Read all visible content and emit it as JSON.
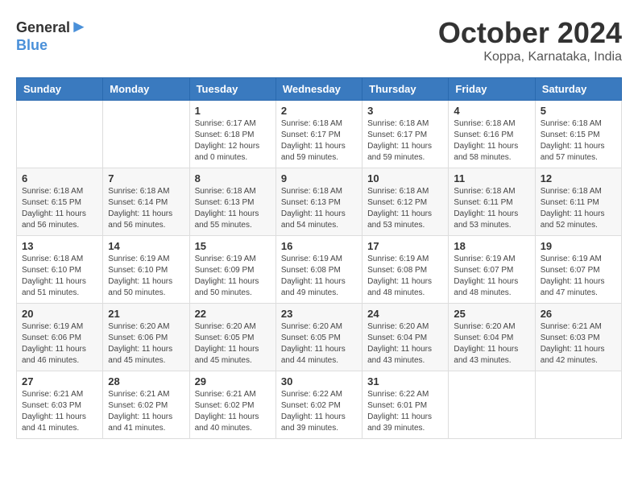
{
  "header": {
    "logo_general": "General",
    "logo_blue": "Blue",
    "title": "October 2024",
    "location": "Koppa, Karnataka, India"
  },
  "weekdays": [
    "Sunday",
    "Monday",
    "Tuesday",
    "Wednesday",
    "Thursday",
    "Friday",
    "Saturday"
  ],
  "weeks": [
    [
      {
        "day": "",
        "sunrise": "",
        "sunset": "",
        "daylight": ""
      },
      {
        "day": "",
        "sunrise": "",
        "sunset": "",
        "daylight": ""
      },
      {
        "day": "1",
        "sunrise": "Sunrise: 6:17 AM",
        "sunset": "Sunset: 6:18 PM",
        "daylight": "Daylight: 12 hours and 0 minutes."
      },
      {
        "day": "2",
        "sunrise": "Sunrise: 6:18 AM",
        "sunset": "Sunset: 6:17 PM",
        "daylight": "Daylight: 11 hours and 59 minutes."
      },
      {
        "day": "3",
        "sunrise": "Sunrise: 6:18 AM",
        "sunset": "Sunset: 6:17 PM",
        "daylight": "Daylight: 11 hours and 59 minutes."
      },
      {
        "day": "4",
        "sunrise": "Sunrise: 6:18 AM",
        "sunset": "Sunset: 6:16 PM",
        "daylight": "Daylight: 11 hours and 58 minutes."
      },
      {
        "day": "5",
        "sunrise": "Sunrise: 6:18 AM",
        "sunset": "Sunset: 6:15 PM",
        "daylight": "Daylight: 11 hours and 57 minutes."
      }
    ],
    [
      {
        "day": "6",
        "sunrise": "Sunrise: 6:18 AM",
        "sunset": "Sunset: 6:15 PM",
        "daylight": "Daylight: 11 hours and 56 minutes."
      },
      {
        "day": "7",
        "sunrise": "Sunrise: 6:18 AM",
        "sunset": "Sunset: 6:14 PM",
        "daylight": "Daylight: 11 hours and 56 minutes."
      },
      {
        "day": "8",
        "sunrise": "Sunrise: 6:18 AM",
        "sunset": "Sunset: 6:13 PM",
        "daylight": "Daylight: 11 hours and 55 minutes."
      },
      {
        "day": "9",
        "sunrise": "Sunrise: 6:18 AM",
        "sunset": "Sunset: 6:13 PM",
        "daylight": "Daylight: 11 hours and 54 minutes."
      },
      {
        "day": "10",
        "sunrise": "Sunrise: 6:18 AM",
        "sunset": "Sunset: 6:12 PM",
        "daylight": "Daylight: 11 hours and 53 minutes."
      },
      {
        "day": "11",
        "sunrise": "Sunrise: 6:18 AM",
        "sunset": "Sunset: 6:11 PM",
        "daylight": "Daylight: 11 hours and 53 minutes."
      },
      {
        "day": "12",
        "sunrise": "Sunrise: 6:18 AM",
        "sunset": "Sunset: 6:11 PM",
        "daylight": "Daylight: 11 hours and 52 minutes."
      }
    ],
    [
      {
        "day": "13",
        "sunrise": "Sunrise: 6:18 AM",
        "sunset": "Sunset: 6:10 PM",
        "daylight": "Daylight: 11 hours and 51 minutes."
      },
      {
        "day": "14",
        "sunrise": "Sunrise: 6:19 AM",
        "sunset": "Sunset: 6:10 PM",
        "daylight": "Daylight: 11 hours and 50 minutes."
      },
      {
        "day": "15",
        "sunrise": "Sunrise: 6:19 AM",
        "sunset": "Sunset: 6:09 PM",
        "daylight": "Daylight: 11 hours and 50 minutes."
      },
      {
        "day": "16",
        "sunrise": "Sunrise: 6:19 AM",
        "sunset": "Sunset: 6:08 PM",
        "daylight": "Daylight: 11 hours and 49 minutes."
      },
      {
        "day": "17",
        "sunrise": "Sunrise: 6:19 AM",
        "sunset": "Sunset: 6:08 PM",
        "daylight": "Daylight: 11 hours and 48 minutes."
      },
      {
        "day": "18",
        "sunrise": "Sunrise: 6:19 AM",
        "sunset": "Sunset: 6:07 PM",
        "daylight": "Daylight: 11 hours and 48 minutes."
      },
      {
        "day": "19",
        "sunrise": "Sunrise: 6:19 AM",
        "sunset": "Sunset: 6:07 PM",
        "daylight": "Daylight: 11 hours and 47 minutes."
      }
    ],
    [
      {
        "day": "20",
        "sunrise": "Sunrise: 6:19 AM",
        "sunset": "Sunset: 6:06 PM",
        "daylight": "Daylight: 11 hours and 46 minutes."
      },
      {
        "day": "21",
        "sunrise": "Sunrise: 6:20 AM",
        "sunset": "Sunset: 6:06 PM",
        "daylight": "Daylight: 11 hours and 45 minutes."
      },
      {
        "day": "22",
        "sunrise": "Sunrise: 6:20 AM",
        "sunset": "Sunset: 6:05 PM",
        "daylight": "Daylight: 11 hours and 45 minutes."
      },
      {
        "day": "23",
        "sunrise": "Sunrise: 6:20 AM",
        "sunset": "Sunset: 6:05 PM",
        "daylight": "Daylight: 11 hours and 44 minutes."
      },
      {
        "day": "24",
        "sunrise": "Sunrise: 6:20 AM",
        "sunset": "Sunset: 6:04 PM",
        "daylight": "Daylight: 11 hours and 43 minutes."
      },
      {
        "day": "25",
        "sunrise": "Sunrise: 6:20 AM",
        "sunset": "Sunset: 6:04 PM",
        "daylight": "Daylight: 11 hours and 43 minutes."
      },
      {
        "day": "26",
        "sunrise": "Sunrise: 6:21 AM",
        "sunset": "Sunset: 6:03 PM",
        "daylight": "Daylight: 11 hours and 42 minutes."
      }
    ],
    [
      {
        "day": "27",
        "sunrise": "Sunrise: 6:21 AM",
        "sunset": "Sunset: 6:03 PM",
        "daylight": "Daylight: 11 hours and 41 minutes."
      },
      {
        "day": "28",
        "sunrise": "Sunrise: 6:21 AM",
        "sunset": "Sunset: 6:02 PM",
        "daylight": "Daylight: 11 hours and 41 minutes."
      },
      {
        "day": "29",
        "sunrise": "Sunrise: 6:21 AM",
        "sunset": "Sunset: 6:02 PM",
        "daylight": "Daylight: 11 hours and 40 minutes."
      },
      {
        "day": "30",
        "sunrise": "Sunrise: 6:22 AM",
        "sunset": "Sunset: 6:02 PM",
        "daylight": "Daylight: 11 hours and 39 minutes."
      },
      {
        "day": "31",
        "sunrise": "Sunrise: 6:22 AM",
        "sunset": "Sunset: 6:01 PM",
        "daylight": "Daylight: 11 hours and 39 minutes."
      },
      {
        "day": "",
        "sunrise": "",
        "sunset": "",
        "daylight": ""
      },
      {
        "day": "",
        "sunrise": "",
        "sunset": "",
        "daylight": ""
      }
    ]
  ]
}
